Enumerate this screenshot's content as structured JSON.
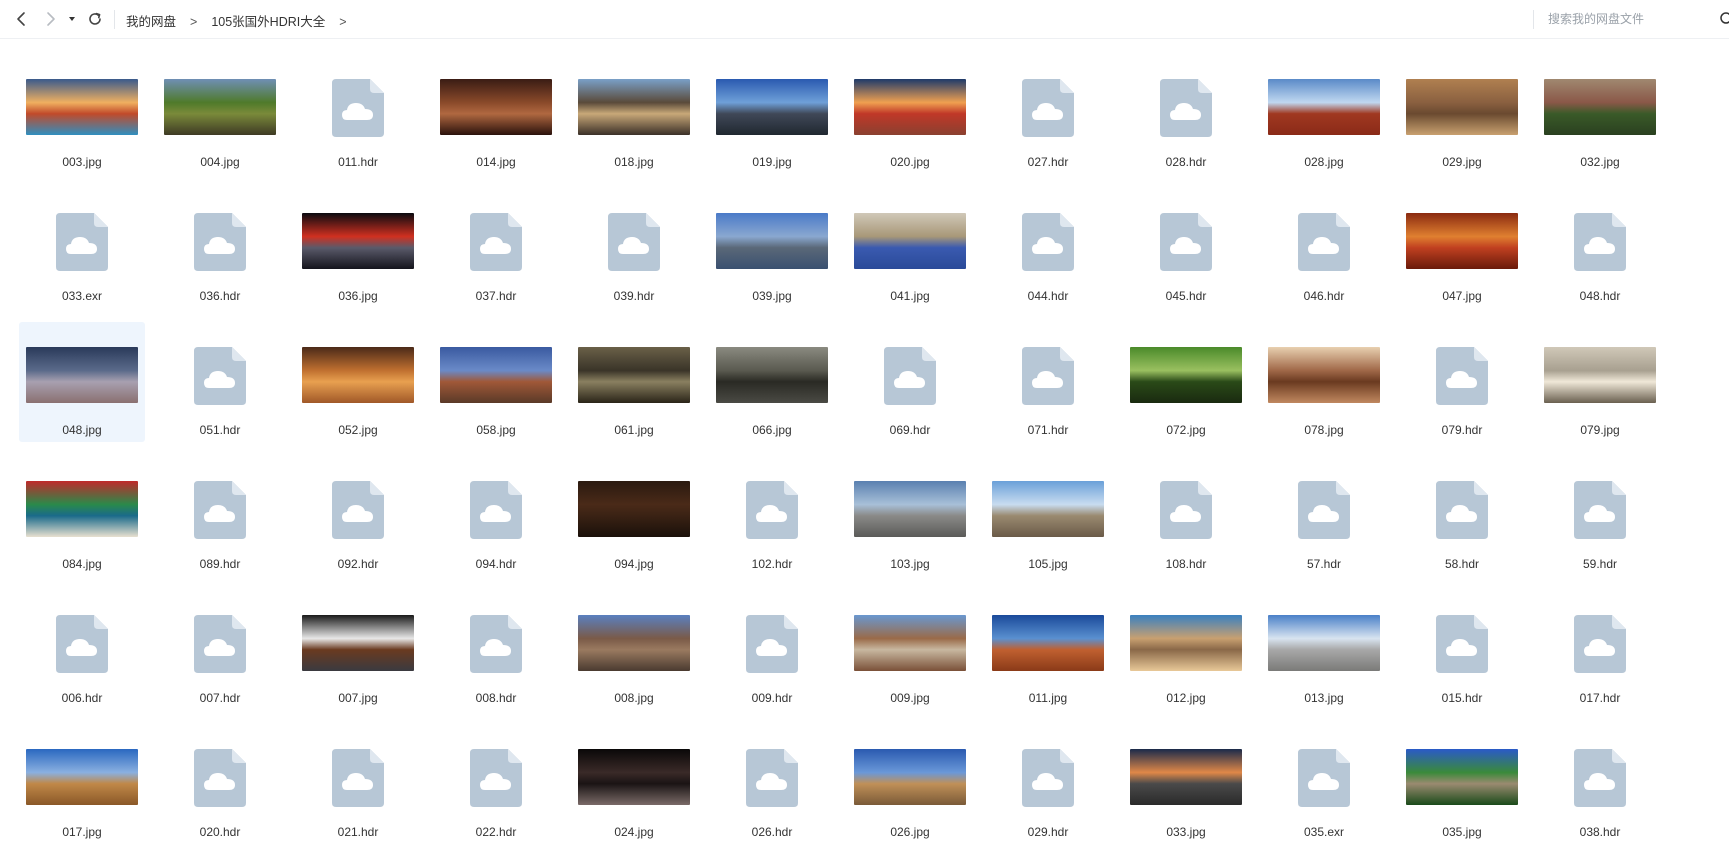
{
  "toolbar": {
    "back_icon": "chevron-left-icon",
    "forward_icon": "chevron-right-icon",
    "dropdown_icon": "caret-down-icon",
    "refresh_icon": "refresh-icon"
  },
  "breadcrumb": {
    "items": [
      "我的网盘",
      "105张国外HDRI大全"
    ],
    "separator": ">"
  },
  "search": {
    "placeholder": "搜索我的网盘文件",
    "icon": "search-icon"
  },
  "colors": {
    "file_icon": "#b7c7d6",
    "selected_bg": "#eef5fd"
  },
  "files": [
    {
      "name": "003.jpg",
      "type": "image",
      "colors": [
        "#3a5a8c",
        "#f0b060",
        "#c14a2a",
        "#2f8fc0"
      ]
    },
    {
      "name": "004.jpg",
      "type": "image",
      "colors": [
        "#6f8fb5",
        "#4f7a2a",
        "#7a8a3a",
        "#3e3a24"
      ]
    },
    {
      "name": "011.hdr",
      "type": "file"
    },
    {
      "name": "014.jpg",
      "type": "image",
      "colors": [
        "#3a1c14",
        "#8a4a2a",
        "#b06840",
        "#2a120c"
      ]
    },
    {
      "name": "018.jpg",
      "type": "image",
      "colors": [
        "#7aa0c8",
        "#5a4a3a",
        "#c8a878",
        "#3a3028"
      ]
    },
    {
      "name": "019.jpg",
      "type": "image",
      "colors": [
        "#2a5ab0",
        "#6fa0d8",
        "#404858",
        "#202830"
      ]
    },
    {
      "name": "020.jpg",
      "type": "image",
      "colors": [
        "#1e3a6a",
        "#f0a050",
        "#c03828",
        "#8a4030"
      ]
    },
    {
      "name": "027.hdr",
      "type": "file"
    },
    {
      "name": "028.hdr",
      "type": "file"
    },
    {
      "name": "028.jpg",
      "type": "image",
      "colors": [
        "#5a8ac8",
        "#c0d8f0",
        "#a03820",
        "#8a2a18"
      ]
    },
    {
      "name": "029.jpg",
      "type": "image",
      "colors": [
        "#b08050",
        "#8a6040",
        "#6a4a30",
        "#c8a070"
      ]
    },
    {
      "name": "032.jpg",
      "type": "image",
      "colors": [
        "#a08870",
        "#8a5848",
        "#3a5a28",
        "#2a4020"
      ]
    },
    {
      "name": "033.exr",
      "type": "file"
    },
    {
      "name": "036.hdr",
      "type": "file"
    },
    {
      "name": "036.jpg",
      "type": "image",
      "colors": [
        "#0a0a10",
        "#d03020",
        "#5a5a6a",
        "#14141c"
      ]
    },
    {
      "name": "037.hdr",
      "type": "file"
    },
    {
      "name": "039.hdr",
      "type": "file"
    },
    {
      "name": "039.jpg",
      "type": "image",
      "colors": [
        "#4a7ac8",
        "#8aa8d0",
        "#5a6878",
        "#3a5070"
      ]
    },
    {
      "name": "041.jpg",
      "type": "image",
      "colors": [
        "#d0c8b8",
        "#a89878",
        "#3a5ab0",
        "#2a4a98"
      ]
    },
    {
      "name": "044.hdr",
      "type": "file"
    },
    {
      "name": "045.hdr",
      "type": "file"
    },
    {
      "name": "046.hdr",
      "type": "file"
    },
    {
      "name": "047.jpg",
      "type": "image",
      "colors": [
        "#8a2a10",
        "#e08030",
        "#c04020",
        "#6a1a0a"
      ]
    },
    {
      "name": "048.hdr",
      "type": "file"
    },
    {
      "name": "048.jpg",
      "type": "image",
      "colors": [
        "#2a3a5a",
        "#5a6a8a",
        "#a8a0b0",
        "#8a7070"
      ]
    },
    {
      "name": "051.hdr",
      "type": "file"
    },
    {
      "name": "052.jpg",
      "type": "image",
      "colors": [
        "#4a2a18",
        "#c07030",
        "#e8a050",
        "#a05828"
      ]
    },
    {
      "name": "058.jpg",
      "type": "image",
      "colors": [
        "#3a5aa0",
        "#6a8ac8",
        "#a05838",
        "#5a3a28"
      ]
    },
    {
      "name": "061.jpg",
      "type": "image",
      "colors": [
        "#6a6048",
        "#3a3428",
        "#8a8060",
        "#2a2418"
      ]
    },
    {
      "name": "066.jpg",
      "type": "image",
      "colors": [
        "#8a8a80",
        "#5a5a50",
        "#2a2a24",
        "#4a4a44"
      ]
    },
    {
      "name": "069.hdr",
      "type": "file"
    },
    {
      "name": "071.hdr",
      "type": "file"
    },
    {
      "name": "072.jpg",
      "type": "image",
      "colors": [
        "#4a8a2a",
        "#9ac060",
        "#2a4a18",
        "#1a2a10"
      ]
    },
    {
      "name": "078.jpg",
      "type": "image",
      "colors": [
        "#e8d0b0",
        "#a06848",
        "#6a3a20",
        "#c08860"
      ]
    },
    {
      "name": "079.hdr",
      "type": "file"
    },
    {
      "name": "079.jpg",
      "type": "image",
      "colors": [
        "#d0c8b8",
        "#a8a090",
        "#f0e8d8",
        "#6a6050"
      ]
    },
    {
      "name": "084.jpg",
      "type": "image",
      "colors": [
        "#c02a2a",
        "#2a8a4a",
        "#1a6a8a",
        "#e8e0d0"
      ]
    },
    {
      "name": "089.hdr",
      "type": "file"
    },
    {
      "name": "092.hdr",
      "type": "file"
    },
    {
      "name": "094.hdr",
      "type": "file"
    },
    {
      "name": "094.jpg",
      "type": "image",
      "colors": [
        "#2a1a10",
        "#4a2a18",
        "#3a2214",
        "#1a100a"
      ]
    },
    {
      "name": "102.hdr",
      "type": "file"
    },
    {
      "name": "103.jpg",
      "type": "image",
      "colors": [
        "#5a80b0",
        "#a8c0d8",
        "#8a8a88",
        "#5a5a58"
      ]
    },
    {
      "name": "105.jpg",
      "type": "image",
      "colors": [
        "#6aa0d8",
        "#c8dcf0",
        "#9a8a70",
        "#6a5a48"
      ]
    },
    {
      "name": "108.hdr",
      "type": "file"
    },
    {
      "name": "57.hdr",
      "type": "file"
    },
    {
      "name": "58.hdr",
      "type": "file"
    },
    {
      "name": "59.hdr",
      "type": "file"
    },
    {
      "name": "006.hdr",
      "type": "file"
    },
    {
      "name": "007.hdr",
      "type": "file"
    },
    {
      "name": "007.jpg",
      "type": "image",
      "colors": [
        "#1a1a1a",
        "#e8e8e8",
        "#6a3a20",
        "#3a3a40"
      ]
    },
    {
      "name": "008.hdr",
      "type": "file"
    },
    {
      "name": "008.jpg",
      "type": "image",
      "colors": [
        "#5a80c0",
        "#7a5a48",
        "#9a7a60",
        "#4a3a30"
      ]
    },
    {
      "name": "009.hdr",
      "type": "file"
    },
    {
      "name": "009.jpg",
      "type": "image",
      "colors": [
        "#6a98d0",
        "#9a6a48",
        "#c8b8a0",
        "#7a5038"
      ]
    },
    {
      "name": "011.jpg",
      "type": "image",
      "colors": [
        "#1a4a9a",
        "#5a90d0",
        "#c06030",
        "#8a3a18"
      ]
    },
    {
      "name": "012.jpg",
      "type": "image",
      "colors": [
        "#3a80c0",
        "#c8a070",
        "#8a6848",
        "#e8c898"
      ]
    },
    {
      "name": "013.jpg",
      "type": "image",
      "colors": [
        "#4a80c8",
        "#d8e4f0",
        "#a8a8a8",
        "#7a7a78"
      ]
    },
    {
      "name": "015.hdr",
      "type": "file"
    },
    {
      "name": "017.hdr",
      "type": "file"
    },
    {
      "name": "017.jpg",
      "type": "image",
      "colors": [
        "#2a68c0",
        "#8ab0e0",
        "#c08848",
        "#8a5828"
      ]
    },
    {
      "name": "020.hdr",
      "type": "file"
    },
    {
      "name": "021.hdr",
      "type": "file"
    },
    {
      "name": "022.hdr",
      "type": "file"
    },
    {
      "name": "024.jpg",
      "type": "image",
      "colors": [
        "#0a0808",
        "#3a2a28",
        "#1a1414",
        "#7a6a68"
      ]
    },
    {
      "name": "026.hdr",
      "type": "file"
    },
    {
      "name": "026.jpg",
      "type": "image",
      "colors": [
        "#2a5ab0",
        "#6a98d8",
        "#c09058",
        "#7a5a38"
      ]
    },
    {
      "name": "029.hdr",
      "type": "file"
    },
    {
      "name": "033.jpg",
      "type": "image",
      "colors": [
        "#1a2a4a",
        "#e08848",
        "#4a4a4a",
        "#2a2a2a"
      ]
    },
    {
      "name": "035.exr",
      "type": "file"
    },
    {
      "name": "035.jpg",
      "type": "image",
      "colors": [
        "#2a5ac8",
        "#3a8a3a",
        "#9a8a70",
        "#1a4a1a"
      ]
    },
    {
      "name": "038.hdr",
      "type": "file"
    }
  ]
}
